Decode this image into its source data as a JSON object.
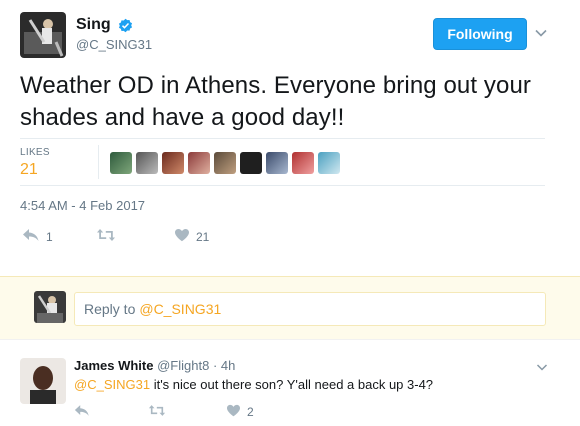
{
  "tweet": {
    "author": {
      "name": "Sing",
      "handle": "@C_SING31",
      "verified": true
    },
    "follow_button_label": "Following",
    "text": "Weather OD in Athens. Everyone bring out your shades and have a good day!!",
    "likes_label": "LIKES",
    "likes_count": "21",
    "timestamp": "4:54 AM - 4 Feb 2017",
    "actions": {
      "reply_count": "1",
      "retweet_count": "",
      "like_count": "21"
    },
    "liker_avatars": [
      "avatar-1",
      "avatar-2",
      "avatar-3",
      "avatar-4",
      "avatar-5",
      "avatar-6",
      "avatar-7",
      "avatar-8",
      "avatar-9"
    ]
  },
  "reply_box": {
    "prefix": "Reply to",
    "mention": "@C_SING31"
  },
  "comment": {
    "author_name": "James White",
    "author_handle": "@Flight8",
    "time": "4h",
    "mention": "@C_SING31",
    "text": "it's nice out there son? Y'all need a back up 3-4?",
    "like_count": "2"
  },
  "colors": {
    "accent": "#1da1f2",
    "mention": "#f5a623",
    "muted": "#657786",
    "reply_background": "#fefbeb"
  }
}
